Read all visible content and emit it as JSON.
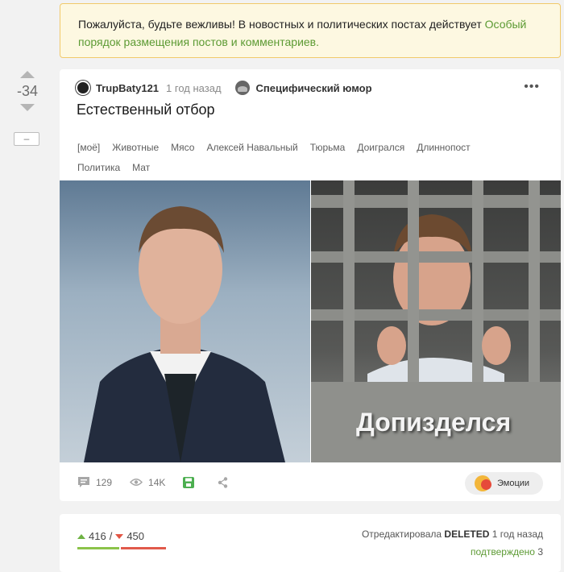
{
  "notice": {
    "text": "Пожалуйста, будьте вежливы! В новостных и политических постах действует ",
    "link": "Особый порядок размещения постов и комментариев."
  },
  "rating": {
    "score": "-34",
    "minus_label": "–"
  },
  "story": {
    "author": "TrupBaty121",
    "time": "1 год назад",
    "community": "Специфический юмор",
    "more_label": "•••",
    "title": "Естественный отбор",
    "tags": [
      "[моё]",
      "Животные",
      "Мясо",
      "Алексей Навальный",
      "Тюрьма",
      "Доигрался",
      "Длиннопост",
      "Политика",
      "Мат"
    ],
    "image_caption": "Допизделся",
    "comments_count": "129",
    "views_count": "14K",
    "emotions_label": "Эмоции"
  },
  "comment": {
    "upvotes": "416",
    "separator": "/",
    "downvotes": "450",
    "up_fraction": 0.48,
    "edited_prefix": "Отредактировала",
    "edited_by": "DELETED",
    "edited_time": "1 год назад",
    "confirmed_label": "подтверждено",
    "confirmed_count": "3"
  },
  "colors": {
    "accent_green": "#5c9a33",
    "notice_bg": "#fdf8e1",
    "upvote": "#6eb243",
    "downvote": "#e25544"
  }
}
